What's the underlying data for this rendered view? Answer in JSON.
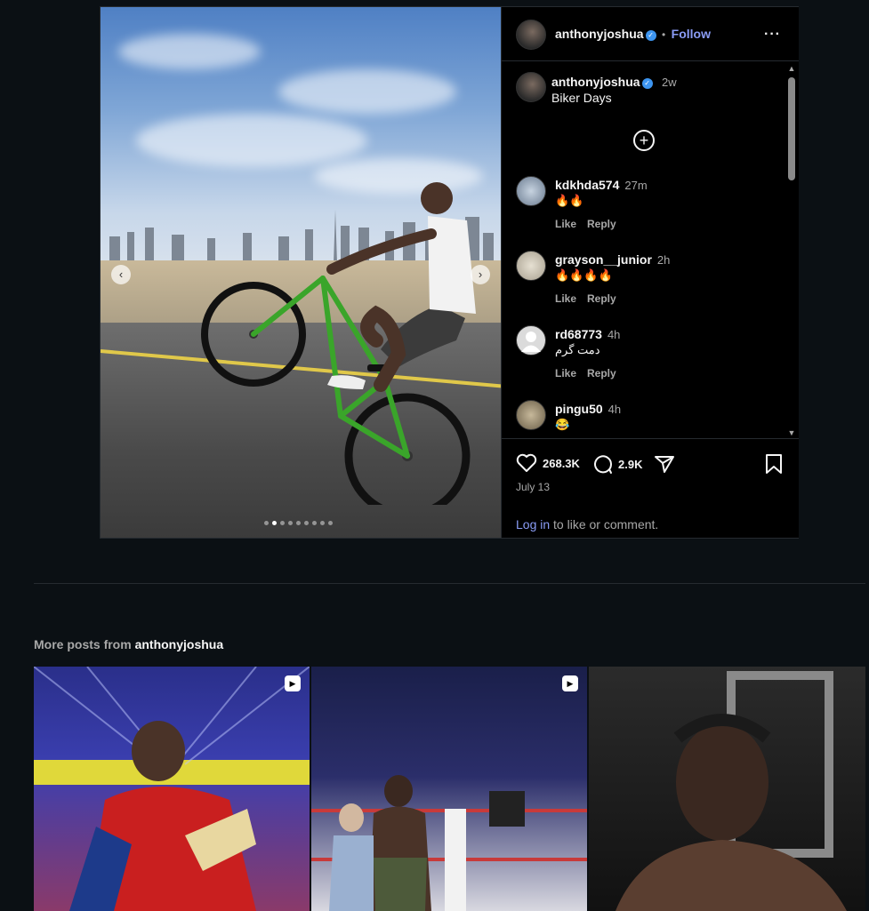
{
  "post": {
    "username": "anthonyjoshua",
    "follow_label": "Follow",
    "separator": "•",
    "caption_user": "anthonyjoshua",
    "caption_age": "2w",
    "caption": "Biker Days",
    "likes": "268.3K",
    "comments_count": "2.9K",
    "date": "July 13",
    "login_link": "Log in",
    "login_rest": " to like or comment."
  },
  "comments": [
    {
      "user": "kdkhda574",
      "age": "27m",
      "text": "🔥🔥",
      "like": "Like",
      "reply": "Reply"
    },
    {
      "user": "grayson__junior",
      "age": "2h",
      "text": "🔥🔥🔥🔥",
      "like": "Like",
      "reply": "Reply"
    },
    {
      "user": "rd68773",
      "age": "4h",
      "text": "دمت گرم",
      "like": "Like",
      "reply": "Reply"
    },
    {
      "user": "pingu50",
      "age": "4h",
      "text": "😂"
    }
  ],
  "more_posts": {
    "prefix": "More posts from ",
    "user": "anthonyjoshua"
  },
  "icons": {
    "verified": "verified-badge-icon",
    "more": "more-options-icon",
    "like": "heart-icon",
    "comment": "comment-bubble-icon",
    "share": "paper-plane-icon",
    "save": "bookmark-icon",
    "reel": "reel-icon"
  },
  "colors": {
    "background": "#0b1014",
    "accent_link": "#8a9cf5",
    "verified": "#3d95f0"
  }
}
